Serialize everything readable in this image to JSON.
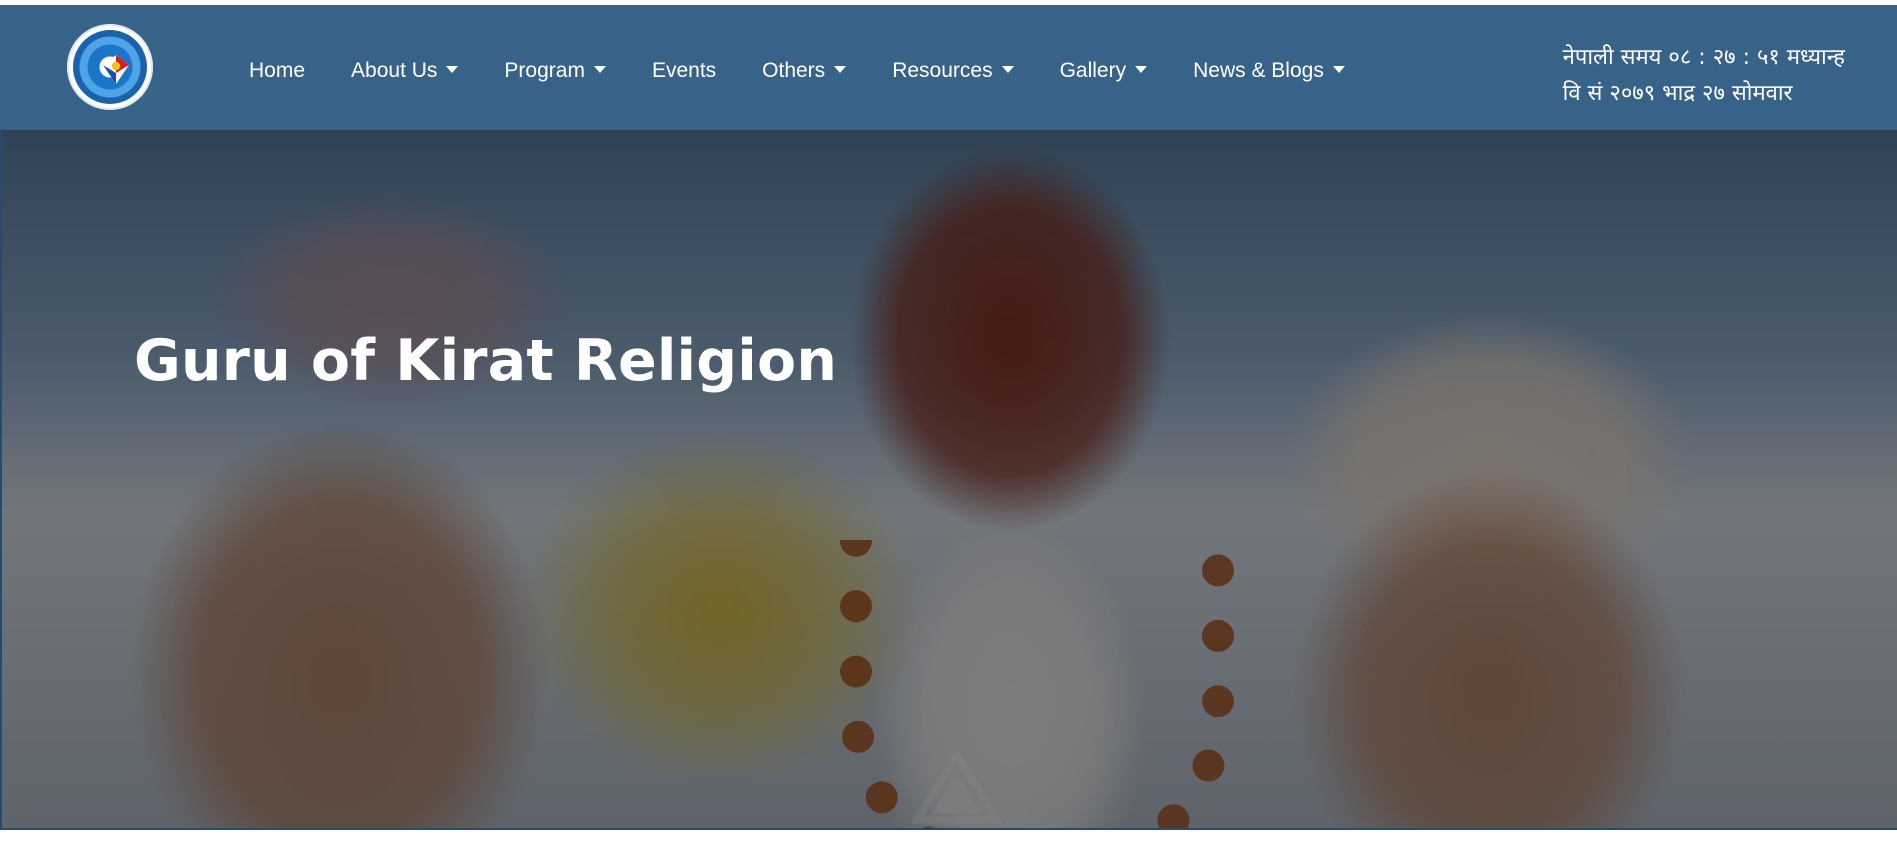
{
  "nav": {
    "items": [
      {
        "label": "Home",
        "has_dropdown": false
      },
      {
        "label": "About Us",
        "has_dropdown": true
      },
      {
        "label": "Program",
        "has_dropdown": true
      },
      {
        "label": "Events",
        "has_dropdown": false
      },
      {
        "label": "Others",
        "has_dropdown": true
      },
      {
        "label": "Resources",
        "has_dropdown": true
      },
      {
        "label": "Gallery",
        "has_dropdown": true
      },
      {
        "label": "News & Blogs",
        "has_dropdown": true
      }
    ]
  },
  "clock": {
    "time_line": "नेपाली समय ०८ : २७ : ५१ मध्यान्ह",
    "date_line": "वि सं २०७९ भाद्र २७ सोमवार"
  },
  "hero": {
    "title": "Guru of Kirat Religion"
  },
  "colors": {
    "navbar": "#386388",
    "title": "#ffffff"
  }
}
